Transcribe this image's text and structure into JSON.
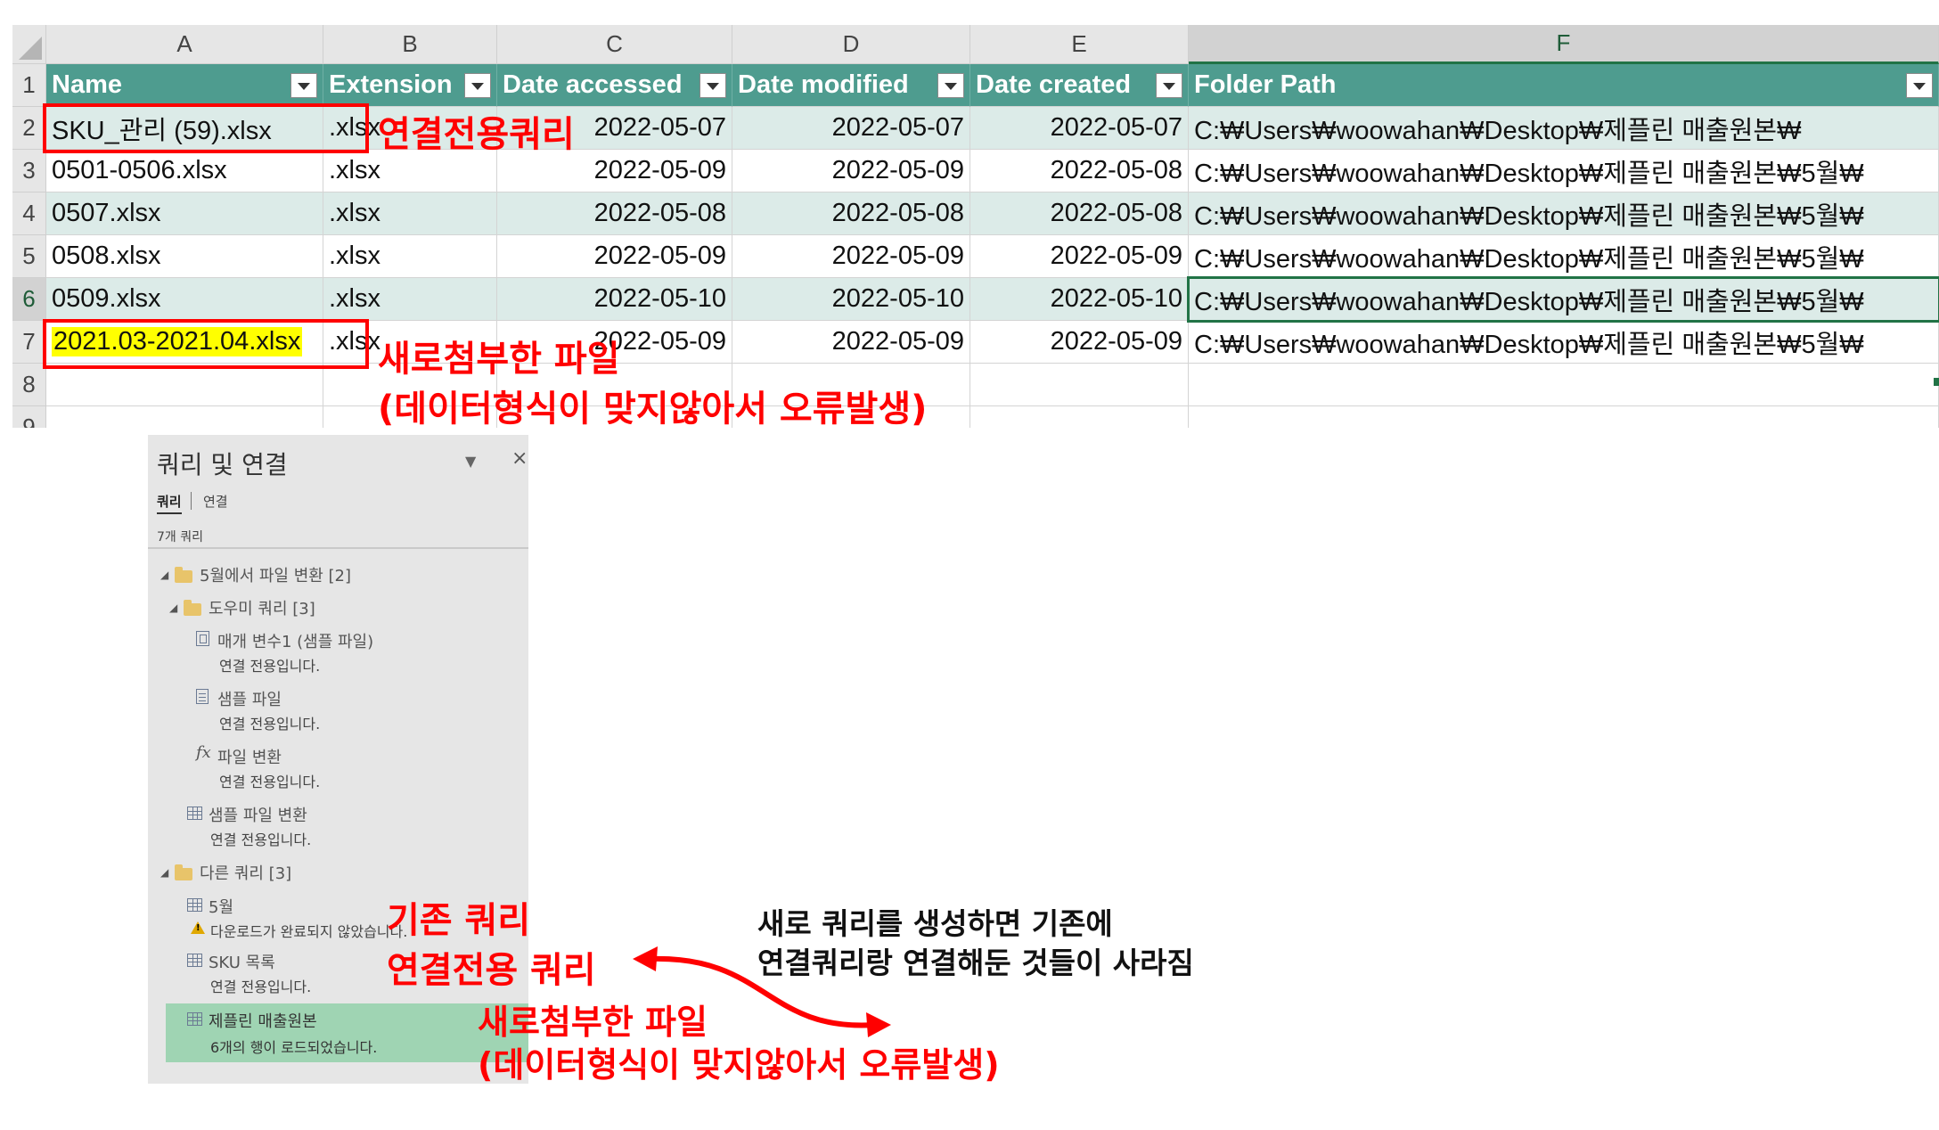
{
  "spreadsheet": {
    "columns": [
      "A",
      "B",
      "C",
      "D",
      "E",
      "F"
    ],
    "rows": [
      "1",
      "2",
      "3",
      "4",
      "5",
      "6",
      "7",
      "8",
      "9"
    ],
    "headers": [
      "Name",
      "Extension",
      "Date accessed",
      "Date modified",
      "Date created",
      "Folder Path"
    ],
    "data": [
      [
        "SKU_관리 (59).xlsx",
        ".xlsx",
        "2022-05-07",
        "2022-05-07",
        "2022-05-07",
        "C:₩Users₩woowahan₩Desktop₩제플린 매출원본₩"
      ],
      [
        "0501-0506.xlsx",
        ".xlsx",
        "2022-05-09",
        "2022-05-09",
        "2022-05-08",
        "C:₩Users₩woowahan₩Desktop₩제플린 매출원본₩5월₩"
      ],
      [
        "0507.xlsx",
        ".xlsx",
        "2022-05-08",
        "2022-05-08",
        "2022-05-08",
        "C:₩Users₩woowahan₩Desktop₩제플린 매출원본₩5월₩"
      ],
      [
        "0508.xlsx",
        ".xlsx",
        "2022-05-09",
        "2022-05-09",
        "2022-05-09",
        "C:₩Users₩woowahan₩Desktop₩제플린 매출원본₩5월₩"
      ],
      [
        "0509.xlsx",
        ".xlsx",
        "2022-05-10",
        "2022-05-10",
        "2022-05-10",
        "C:₩Users₩woowahan₩Desktop₩제플린 매출원본₩5월₩"
      ],
      [
        "2021.03-2021.04.xlsx",
        ".xlsx",
        "2022-05-09",
        "2022-05-09",
        "2022-05-09",
        "C:₩Users₩woowahan₩Desktop₩제플린 매출원본₩5월₩"
      ]
    ],
    "selected_cell": "F6"
  },
  "annotations": {
    "top_connection_only": "연결전용쿼리",
    "top_new_file": "새로첨부한 파일",
    "top_error": "(데이터형식이 맞지않아서 오류발생)",
    "existing_query": "기존 쿼리",
    "connection_query": "연결전용 쿼리",
    "new_file": "새로첨부한 파일",
    "error": "(데이터형식이 맞지않아서 오류발생)",
    "note_line1": "새로 쿼리를 생성하면 기존에",
    "note_line2": "연결쿼리랑 연결해둔 것들이 사라짐",
    "accent_color": "#ff0000"
  },
  "query_pane": {
    "title": "쿼리 및 연결",
    "tab_queries": "쿼리",
    "tab_connections": "연결",
    "count": "7개 쿼리",
    "group1": "5월에서 파일 변환 [2]",
    "group1_sub": "도우미 쿼리 [3]",
    "items": [
      {
        "name": "매개 변수1 (샘플 파일)",
        "status": "연결 전용입니다.",
        "icon": "parameter-icon"
      },
      {
        "name": "샘플 파일",
        "status": "연결 전용입니다.",
        "icon": "document-icon"
      },
      {
        "name": "파일 변환",
        "status": "연결 전용입니다.",
        "icon": "function-icon"
      },
      {
        "name": "샘플 파일 변환",
        "status": "연결 전용입니다.",
        "icon": "table-icon"
      }
    ],
    "group2": "다른 쿼리 [3]",
    "others": [
      {
        "name": "5월",
        "status": "다운로드가 완료되지 않았습니다.",
        "icon": "table-icon"
      },
      {
        "name": "SKU 목록",
        "status": "연결 전용입니다.",
        "icon": "table-icon"
      },
      {
        "name": "제플린 매출원본",
        "status": "6개의 행이 로드되었습니다.",
        "icon": "table-icon"
      }
    ],
    "header_color": "#4e9c8f",
    "selected_color": "#9fd4b3"
  }
}
